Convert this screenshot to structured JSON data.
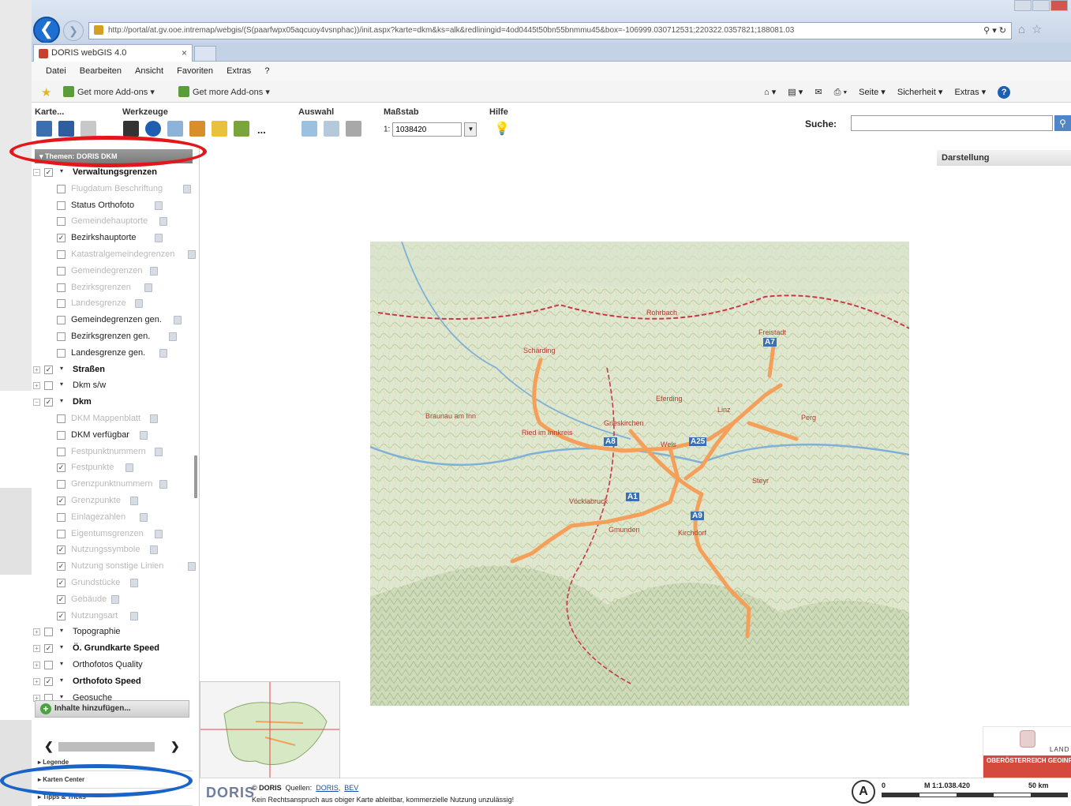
{
  "browser": {
    "url": "http://portal/at.gv.ooe.intremap/webgis/(S(paarfwpx05aqcuoy4vsnphac))/init.aspx?karte=dkm&ks=alk&redliningid=4od0445t50bn55bnmmu45&box=-106999.030712531;220322.0357821;188081.03",
    "tab_title": "DORIS webGIS 4.0",
    "tab_close": "×",
    "menu": [
      "Datei",
      "Bearbeiten",
      "Ansicht",
      "Favoriten",
      "Extras",
      "?"
    ],
    "addons": [
      "Get more Add-ons ▾",
      "Get more Add-ons ▾"
    ],
    "cmd_right": [
      "Seite ▾",
      "Sicherheit ▾",
      "Extras ▾"
    ],
    "help": "?"
  },
  "toolbar": {
    "groups": [
      "Karte...",
      "Werkzeuge",
      "Auswahl",
      "Maßstab",
      "Hilfe"
    ],
    "more": "...",
    "scale_prefix": "1:",
    "scale_value": "1038420",
    "search_label": "Suche:",
    "search_value": ""
  },
  "left_panel": {
    "theme_header": "▾  Themen: DORIS DKM",
    "tree": [
      {
        "label": "Verwaltungsgrenzen",
        "level": 0,
        "checked": true,
        "style": "bold",
        "expander": "−"
      },
      {
        "label": "Flugdatum Beschriftung",
        "level": 1,
        "checked": false,
        "style": "dim"
      },
      {
        "label": "Status Orthofoto",
        "level": 1,
        "checked": false,
        "style": "norm"
      },
      {
        "label": "Gemeindehauptorte",
        "level": 1,
        "checked": false,
        "style": "dim"
      },
      {
        "label": "Bezirkshauptorte",
        "level": 1,
        "checked": true,
        "style": "norm"
      },
      {
        "label": "Katastralgemeindegrenzen",
        "level": 1,
        "checked": false,
        "style": "dim"
      },
      {
        "label": "Gemeindegrenzen",
        "level": 1,
        "checked": false,
        "style": "dim"
      },
      {
        "label": "Bezirksgrenzen",
        "level": 1,
        "checked": false,
        "style": "dim"
      },
      {
        "label": "Landesgrenze",
        "level": 1,
        "checked": false,
        "style": "dim"
      },
      {
        "label": "Gemeindegrenzen gen.",
        "level": 1,
        "checked": false,
        "style": "norm"
      },
      {
        "label": "Bezirksgrenzen gen.",
        "level": 1,
        "checked": false,
        "style": "norm"
      },
      {
        "label": "Landesgrenze gen.",
        "level": 1,
        "checked": false,
        "style": "norm"
      },
      {
        "label": "Straßen",
        "level": 0,
        "checked": true,
        "style": "bold",
        "expander": "+"
      },
      {
        "label": "Dkm s/w",
        "level": 0,
        "checked": false,
        "style": "norm",
        "expander": "+"
      },
      {
        "label": "Dkm",
        "level": 0,
        "checked": true,
        "style": "bold",
        "expander": "−"
      },
      {
        "label": "DKM Mappenblatt",
        "level": 1,
        "checked": false,
        "style": "dim"
      },
      {
        "label": "DKM verfügbar",
        "level": 1,
        "checked": false,
        "style": "norm"
      },
      {
        "label": "Festpunktnummern",
        "level": 1,
        "checked": false,
        "style": "dim"
      },
      {
        "label": "Festpunkte",
        "level": 1,
        "checked": true,
        "style": "dim"
      },
      {
        "label": "Grenzpunktnummern",
        "level": 1,
        "checked": false,
        "style": "dim"
      },
      {
        "label": "Grenzpunkte",
        "level": 1,
        "checked": true,
        "style": "dim"
      },
      {
        "label": "Einlagezahlen",
        "level": 1,
        "checked": false,
        "style": "dim"
      },
      {
        "label": "Eigentumsgrenzen",
        "level": 1,
        "checked": false,
        "style": "dim"
      },
      {
        "label": "Nutzungssymbole",
        "level": 1,
        "checked": true,
        "style": "dim"
      },
      {
        "label": "Nutzung sonstige Linien",
        "level": 1,
        "checked": true,
        "style": "dim"
      },
      {
        "label": "Grundstücke",
        "level": 1,
        "checked": true,
        "style": "dim"
      },
      {
        "label": "Gebäude",
        "level": 1,
        "checked": true,
        "style": "dim"
      },
      {
        "label": "Nutzungsart",
        "level": 1,
        "checked": true,
        "style": "dim"
      },
      {
        "label": "Topographie",
        "level": 0,
        "checked": false,
        "style": "norm",
        "expander": "+"
      },
      {
        "label": "Ö. Grundkarte Speed",
        "level": 0,
        "checked": true,
        "style": "bold",
        "expander": "+"
      },
      {
        "label": "Orthofotos Quality",
        "level": 0,
        "checked": false,
        "style": "norm",
        "expander": "+"
      },
      {
        "label": "Orthofoto Speed",
        "level": 0,
        "checked": true,
        "style": "bold",
        "expander": "+"
      },
      {
        "label": "Geosuche",
        "level": 0,
        "checked": false,
        "style": "norm",
        "expander": "+"
      }
    ],
    "add_content": "Inhalte hinzufügen...",
    "accordion": [
      "▸ Legende",
      "▸ Karten Center",
      "▸ Tipps & Tricks"
    ]
  },
  "map": {
    "panel_title": "Darstellung",
    "places": [
      "Rohrbach",
      "Freistadt",
      "Schärding",
      "Eferding",
      "Braunau am Inn",
      "Ried im Innkreis",
      "Grieskirchen",
      "Wels",
      "Linz",
      "Perg",
      "Steyr",
      "Vöcklabruck",
      "Gmunden",
      "Kirchdorf"
    ],
    "road_labels": [
      "A8",
      "A7",
      "A1",
      "A9",
      "A25"
    ]
  },
  "footer": {
    "logo": "DORIS",
    "copyright_lead": "© DORIS",
    "sources_label": "Quellen:",
    "source_links": [
      "DORIS",
      "BEV"
    ],
    "disclaimer": "Kein Rechtsanspruch aus obiger Karte ableitbar, kommerzielle Nutzung unzulässig!",
    "north": "A",
    "scale_zero": "0",
    "scale_text": "M 1:1.038.420",
    "scale_max": "50 km",
    "logo_land": "LAND",
    "logo_band": "OBERÖSTERREICH GEOINFORMATION"
  },
  "colors": {
    "annotation_red": "#e4161c",
    "annotation_blue": "#1a64c8",
    "route": "#f5a05a",
    "ie_blue": "#1e6fd0"
  }
}
